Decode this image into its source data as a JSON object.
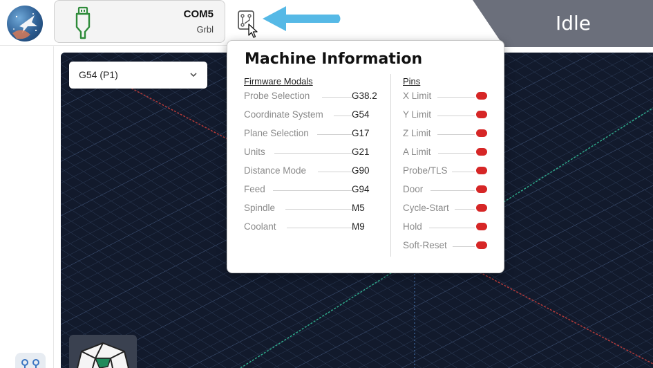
{
  "header": {
    "connection": {
      "port": "COM5",
      "firmware": "Grbl"
    },
    "status": "Idle"
  },
  "visualizer": {
    "wcs_select": {
      "value": "G54 (P1)"
    }
  },
  "machine_info": {
    "title": "Machine Information",
    "firmware_modals": {
      "heading": "Firmware Modals",
      "items": [
        {
          "label": "Probe Selection",
          "value": "G38.2"
        },
        {
          "label": "Coordinate System",
          "value": "G54"
        },
        {
          "label": "Plane Selection",
          "value": "G17"
        },
        {
          "label": "Units",
          "value": "G21"
        },
        {
          "label": "Distance Mode",
          "value": "G90"
        },
        {
          "label": "Feed",
          "value": "G94"
        },
        {
          "label": "Spindle",
          "value": "M5"
        },
        {
          "label": "Coolant",
          "value": "M9"
        }
      ]
    },
    "pins": {
      "heading": "Pins",
      "led_color": "#d62626",
      "items": [
        {
          "label": "X Limit",
          "active": false
        },
        {
          "label": "Y Limit",
          "active": false
        },
        {
          "label": "Z Limit",
          "active": false
        },
        {
          "label": "A Limit",
          "active": false
        },
        {
          "label": "Probe/TLS",
          "active": false
        },
        {
          "label": "Door",
          "active": false
        },
        {
          "label": "Cycle-Start",
          "active": false
        },
        {
          "label": "Hold",
          "active": false
        },
        {
          "label": "Soft-Reset",
          "active": false
        }
      ]
    }
  },
  "colors": {
    "status_bg": "#6b6f7b",
    "accent_arrow": "#56b9e6",
    "usb_green": "#2e8b3a",
    "visualizer_bg": "#121a2c"
  },
  "icons": {
    "logo": "gsender-logo",
    "connection": "usb-icon",
    "machine_info": "circuit-board-icon",
    "pointer": "mouse-cursor-icon",
    "dropdown": "chevron-down-icon"
  }
}
